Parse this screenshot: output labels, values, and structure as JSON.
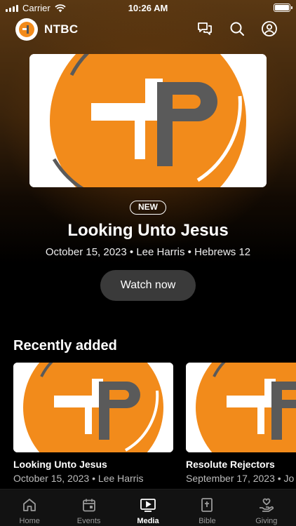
{
  "status_bar": {
    "carrier": "Carrier",
    "time": "10:26 AM"
  },
  "header": {
    "app_name": "NTBC",
    "icons": [
      "chat-icon",
      "search-icon",
      "profile-icon"
    ]
  },
  "featured": {
    "badge": "NEW",
    "title": "Looking Unto Jesus",
    "meta": "October 15, 2023 • Lee Harris • Hebrews 12",
    "button_label": "Watch now"
  },
  "recently_added": {
    "heading": "Recently added",
    "items": [
      {
        "title": "Looking Unto Jesus",
        "meta": "October 15, 2023 • Lee Harris"
      },
      {
        "title": "Resolute Rejectors",
        "meta": "September 17, 2023 • Jo"
      }
    ]
  },
  "tab_bar": {
    "active": "Media",
    "tabs": [
      {
        "label": "Home",
        "icon": "home-icon"
      },
      {
        "label": "Events",
        "icon": "calendar-icon"
      },
      {
        "label": "Media",
        "icon": "play-icon"
      },
      {
        "label": "Bible",
        "icon": "bible-icon"
      },
      {
        "label": "Giving",
        "icon": "giving-icon"
      }
    ]
  },
  "colors": {
    "accent_orange": "#F28B1B",
    "logo_gray": "#5A5A5A",
    "button_bg": "#3A3A3A",
    "tabbar_bg": "#121212"
  }
}
